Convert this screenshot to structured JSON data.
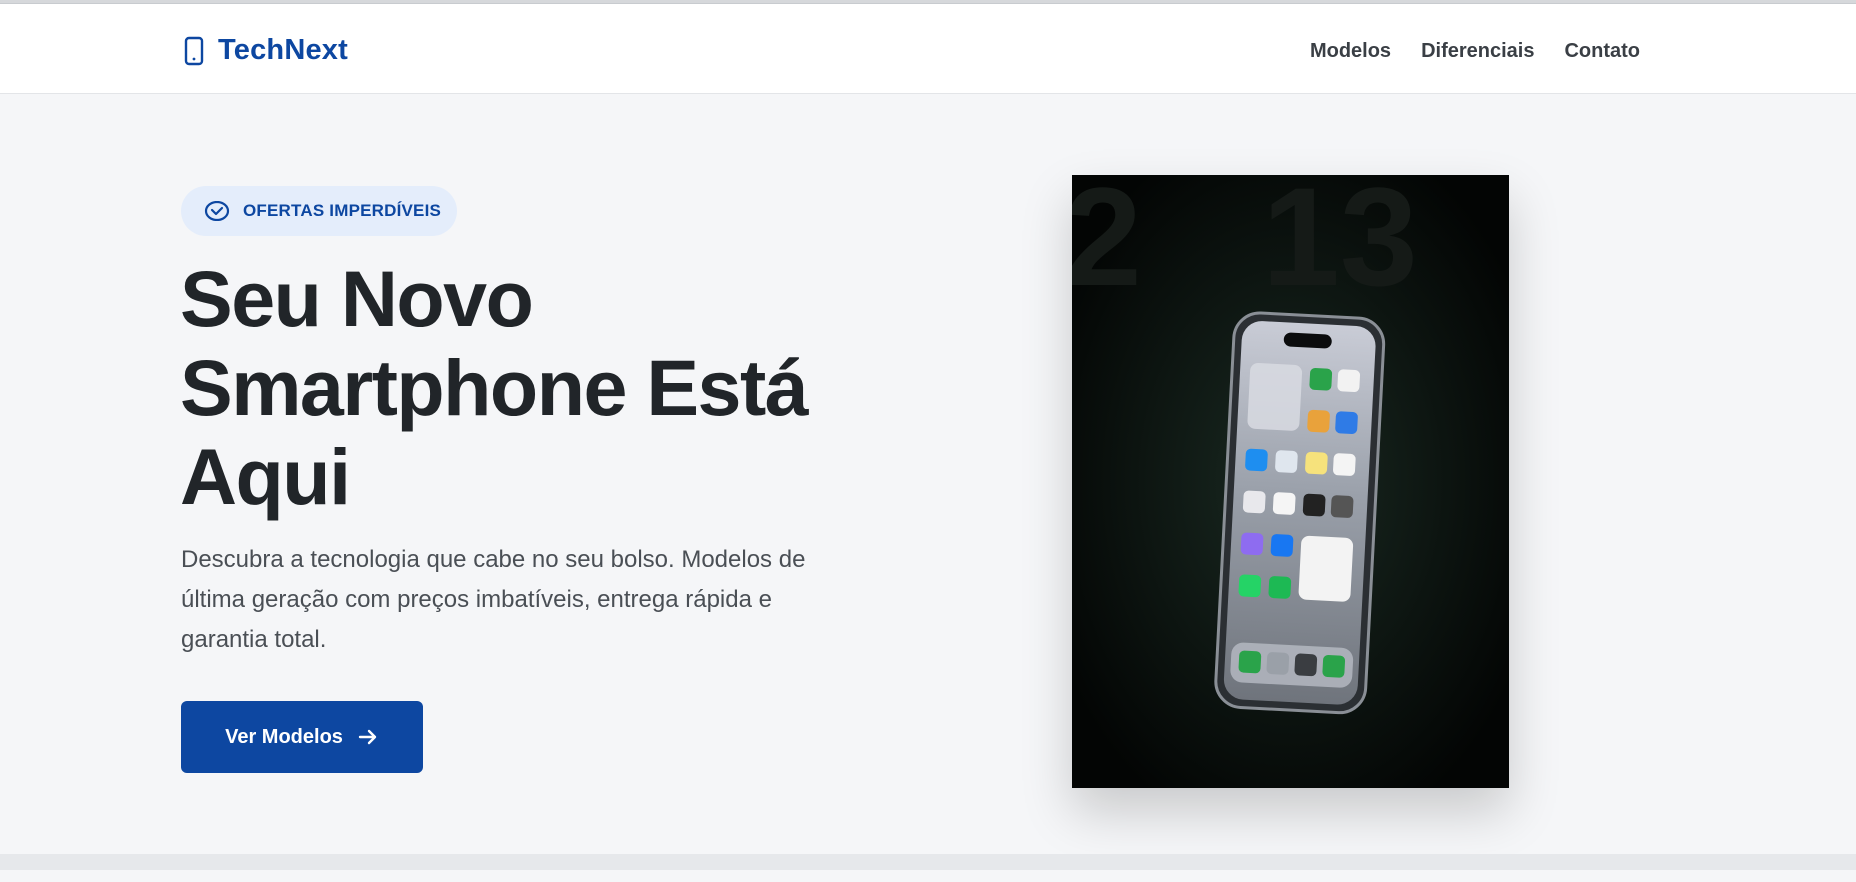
{
  "brand": {
    "name": "TechNext",
    "icon": "smartphone-icon",
    "color": "#0d47a1"
  },
  "nav": {
    "items": [
      {
        "label": "Modelos"
      },
      {
        "label": "Diferenciais"
      },
      {
        "label": "Contato"
      }
    ]
  },
  "hero": {
    "badge": {
      "icon": "badge-check-icon",
      "label": "OFERTAS IMPERDÍVEIS"
    },
    "title": "Seu Novo Smartphone Está Aqui",
    "lead": "Descubra a tecnologia que cabe no seu bolso. Modelos de última geração com preços imbatíveis, entrega rápida e garantia total.",
    "cta": {
      "label": "Ver Modelos",
      "icon": "arrow-right-icon"
    },
    "image": {
      "subject": "smartphone-photo",
      "background_digits": "2 13"
    }
  },
  "colors": {
    "accent": "#0d47a1",
    "badge_bg": "#e4edfb",
    "heading": "#212529",
    "page_bg": "#f5f6f8"
  }
}
